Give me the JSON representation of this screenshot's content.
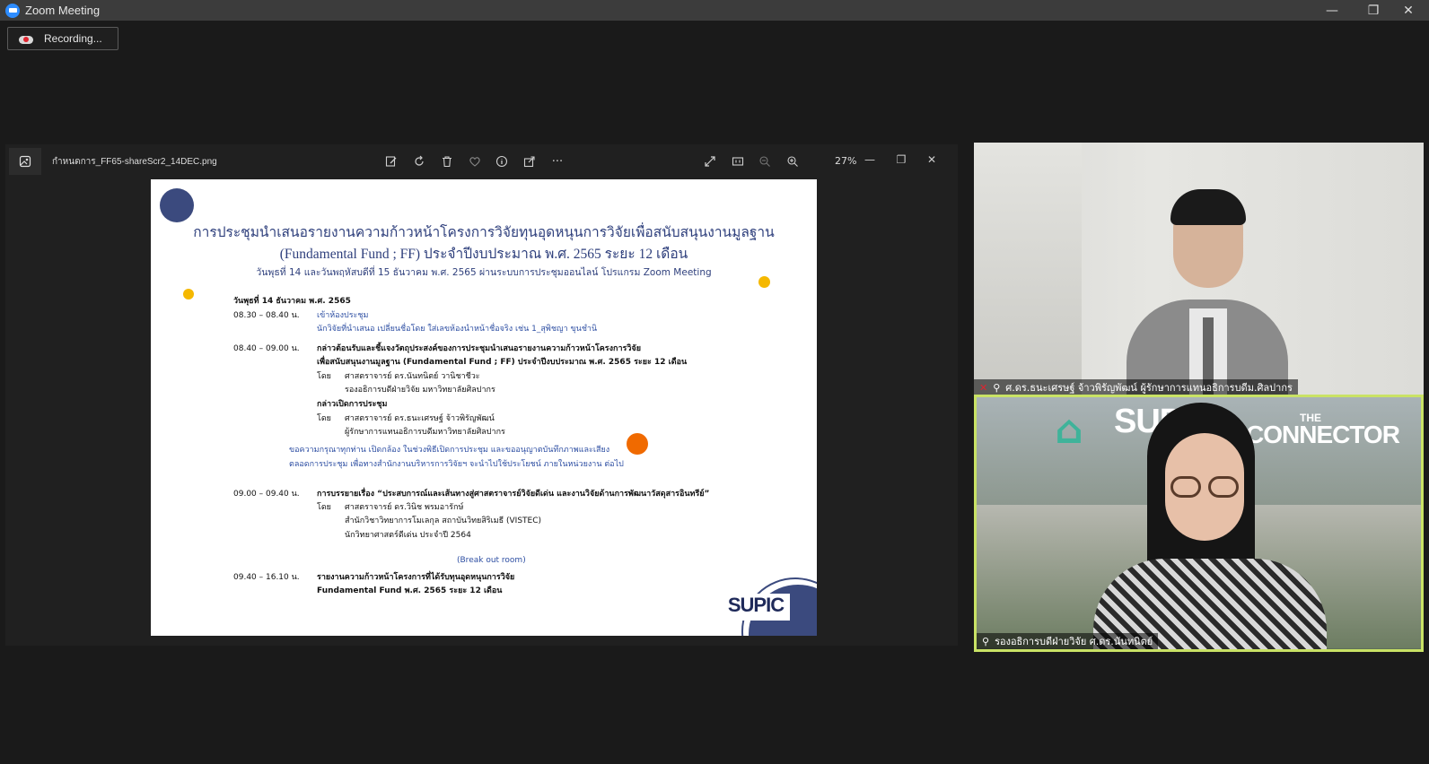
{
  "window": {
    "title": "Zoom Meeting",
    "minimize": "—",
    "restore": "❐",
    "close": "✕"
  },
  "recording": {
    "label": "Recording..."
  },
  "viewer": {
    "filename": "กำหนดการ_FF65-shareScr2_14DEC.png",
    "zoom": "27%",
    "more": "···"
  },
  "slide": {
    "title_line1": "การประชุมนำเสนอรายงานความก้าวหน้าโครงการวิจัยทุนอุดหนุนการวิจัยเพื่อสนับสนุนงานมูลฐาน",
    "title_line2": "(Fundamental Fund ; FF) ประจำปีงบประมาณ พ.ศ. 2565 ระยะ 12 เดือน",
    "subtitle": "วันพุธที่ 14 และวันพฤหัสบดีที่ 15 ธันวาคม พ.ศ. 2565  ผ่านระบบการประชุมออนไลน์ โปรแกรม Zoom Meeting",
    "date_heading": "วันพุธที่ 14 ธันวาคม พ.ศ. 2565",
    "t1": "08.30 – 08.40 น.",
    "a1": "เข้าห้องประชุม",
    "a1b": "นักวิจัยที่นำเสนอ เปลี่ยนชื่อโดย ใส่เลขห้องนำหน้าชื่อจริง เช่น 1_สุพิชญา ขุนชำนิ",
    "t2": "08.40 – 09.00 น.",
    "a2": "กล่าวต้อนรับและชี้แจงวัตถุประสงค์ของการประชุมนำเสนอรายงานความก้าวหน้าโครงการวิจัย",
    "a2b": "เพื่อสนับสนุนงานมูลฐาน (Fundamental Fund ; FF) ประจำปีงบประมาณ พ.ศ. 2565 ระยะ 12 เดือน",
    "by": "โดย",
    "p1": "ศาสตราจารย์ ดร.นันทนิตย์ วานิชาชีวะ",
    "p1b": "รองอธิการบดีฝ่ายวิจัย มหาวิทยาลัยศิลปากร",
    "a3": "กล่าวเปิดการประชุม",
    "p2": "ศาสตราจารย์ ดร.ธนะเศรษฐ์ จ้าวพิรัญพัฒน์",
    "p2b": "ผู้รักษาการแทนอธิการบดีมหาวิทยาลัยศิลปากร",
    "note1": "ขอความกรุณาทุกท่าน เปิดกล้อง ในช่วงพิธีเปิดการประชุม และขออนุญาตบันทึกภาพและเสียง",
    "note2": "ตลอดการประชุม เพื่อทางสำนักงานบริหารการวิจัยฯ จะนำไปใช้ประโยชน์ ภายในหน่วยงาน ต่อไป",
    "t3": "09.00 – 09.40 น.",
    "a4": "การบรรยายเรื่อง “ประสบการณ์และเส้นทางสู่ศาสตราจารย์วิจัยดีเด่น และงานวิจัยด้านการพัฒนาวัสดุสารอินทรีย์”",
    "p3": "ศาสตราจารย์ ดร.วินิช พรมอารักษ์",
    "p3b": "สำนักวิชาวิทยาการโมเลกุล สถาบันวิทยสิริเมธี (VISTEC)",
    "p3c": "นักวิทยาศาสตร์ดีเด่น ประจำปี 2564",
    "breakout": "(Break out room)",
    "t4": "09.40 – 16.10 น.",
    "a5": "รายงานความก้าวหน้าโครงการที่ได้รับทุนอุดหนุนการวิจัย",
    "a5b": "Fundamental Fund พ.ศ. 2565 ระยะ 12 เดือน",
    "logo": "SUPIC"
  },
  "participants": [
    {
      "name": "ศ.ดร.ธนะเศรษฐ์ จ้าวพิรัญพัฒน์ ผู้รักษาการแทนอธิการบดีม.ศิลปากร"
    },
    {
      "name": "รองอธิการบดีฝ่ายวิจัย ศ.ดร.นันทนิตย์"
    }
  ],
  "background_logos": {
    "left": "SUPIC",
    "right_top": "THE",
    "right": "CONNECTOR"
  },
  "colors": {
    "accent_speaker": "#c9e265",
    "slide_blue": "#2e3f7c",
    "dot_yellow": "#f5b800",
    "dot_orange": "#f06a00",
    "muted_red": "#e0242f"
  }
}
